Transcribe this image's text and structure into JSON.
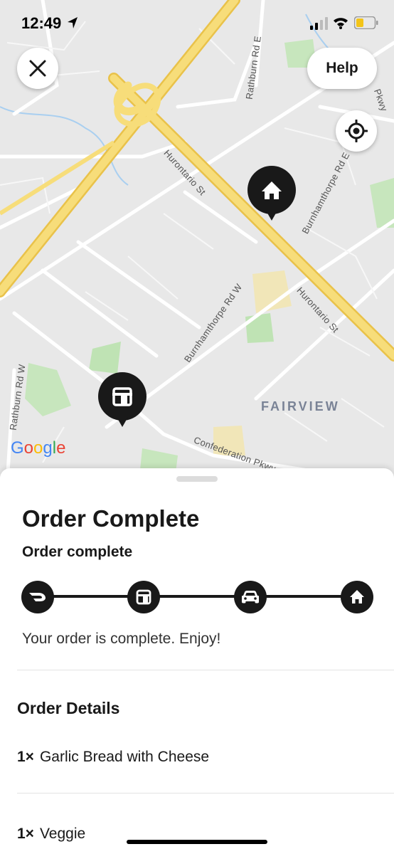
{
  "status_bar": {
    "time": "12:49"
  },
  "map": {
    "labels": {
      "rathburn_e": "Rathburn Rd E",
      "hurontario_1": "Hurontario St",
      "burnhamthorpe_e": "Burnhamthorpe Rd E",
      "pkwy_top": "Pkwy",
      "burnhamthorpe_w": "Burnhamthorpe Rd W",
      "hurontario_2": "Hurontario St",
      "rathburn_w": "Rathburn Rd W",
      "fairview": "FAIRVIEW",
      "confederation": "Confederation Pkwy"
    },
    "google_logo": "Google",
    "help_label": "Help"
  },
  "order": {
    "title": "Order Complete",
    "subtitle": "Order complete",
    "message": "Your order is complete. Enjoy!",
    "steps": [
      "dasher-logo-icon",
      "store-icon",
      "car-icon",
      "home-icon"
    ],
    "details_heading": "Order Details",
    "items": [
      {
        "qty": "1×",
        "name": "Garlic Bread with Cheese"
      },
      {
        "qty": "1×",
        "name": "Veggie"
      }
    ]
  },
  "colors": {
    "map_bg": "#e8e8e8",
    "highway": "#f6d56a",
    "park": "#bfe3b4",
    "water": "#a9cff0",
    "pin": "#191919"
  }
}
